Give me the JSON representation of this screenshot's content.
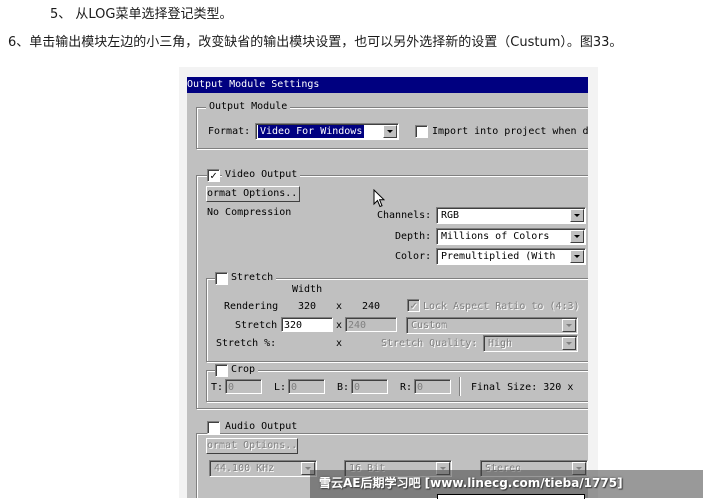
{
  "doc": {
    "line1": "5、 从LOG菜单选择登记类型。",
    "line2": "6、单击输出模块左边的小三角，改变缺省的输出模块设置，也可以另外选择新的设置（Custum）。图33。"
  },
  "window": {
    "title": "Output Module Settings"
  },
  "output_module": {
    "legend": "Output Module",
    "format_label": "Format:",
    "format_value": "Video For Windows",
    "import_label": "Import into project when d"
  },
  "video_output": {
    "legend": "Video Output",
    "checked": true,
    "format_options_button": "ormat Options...",
    "compression": "No Compression",
    "channels_label": "Channels:",
    "channels_value": "RGB",
    "depth_label": "Depth:",
    "depth_value": "Millions of Colors",
    "color_label": "Color:",
    "color_value": "Premultiplied (With"
  },
  "stretch": {
    "legend": "Stretch",
    "width_header": "Width",
    "rendering_label": "Rendering",
    "rendering_width": "320",
    "x1": "x",
    "rendering_height": "240",
    "lock_aspect": "Lock Aspect Ratio to (4:3)",
    "stretch_label": "Stretch",
    "stretch_width": "320",
    "x2": "x",
    "stretch_height": "240",
    "preset_value": "Custom",
    "stretch_pct_label": "Stretch %:",
    "x3": "x",
    "quality_label": "Stretch Quality:",
    "quality_value": "High"
  },
  "crop": {
    "legend": "Crop",
    "t_label": "T:",
    "t_value": "0",
    "l_label": "L:",
    "l_value": "0",
    "b_label": "B:",
    "b_value": "0",
    "r_label": "R:",
    "r_value": "0",
    "final_size": "Final Size: 320 x"
  },
  "audio_output": {
    "legend": "Audio Output",
    "checked": false,
    "format_options_button": "ormat Options...",
    "rate_value": "44.100 KHz",
    "bits_value": "16 Bit",
    "channels_value": "Stereo"
  },
  "watermark": "雪云AE后期学习吧 [www.linecg.com/tieba/1775]"
}
